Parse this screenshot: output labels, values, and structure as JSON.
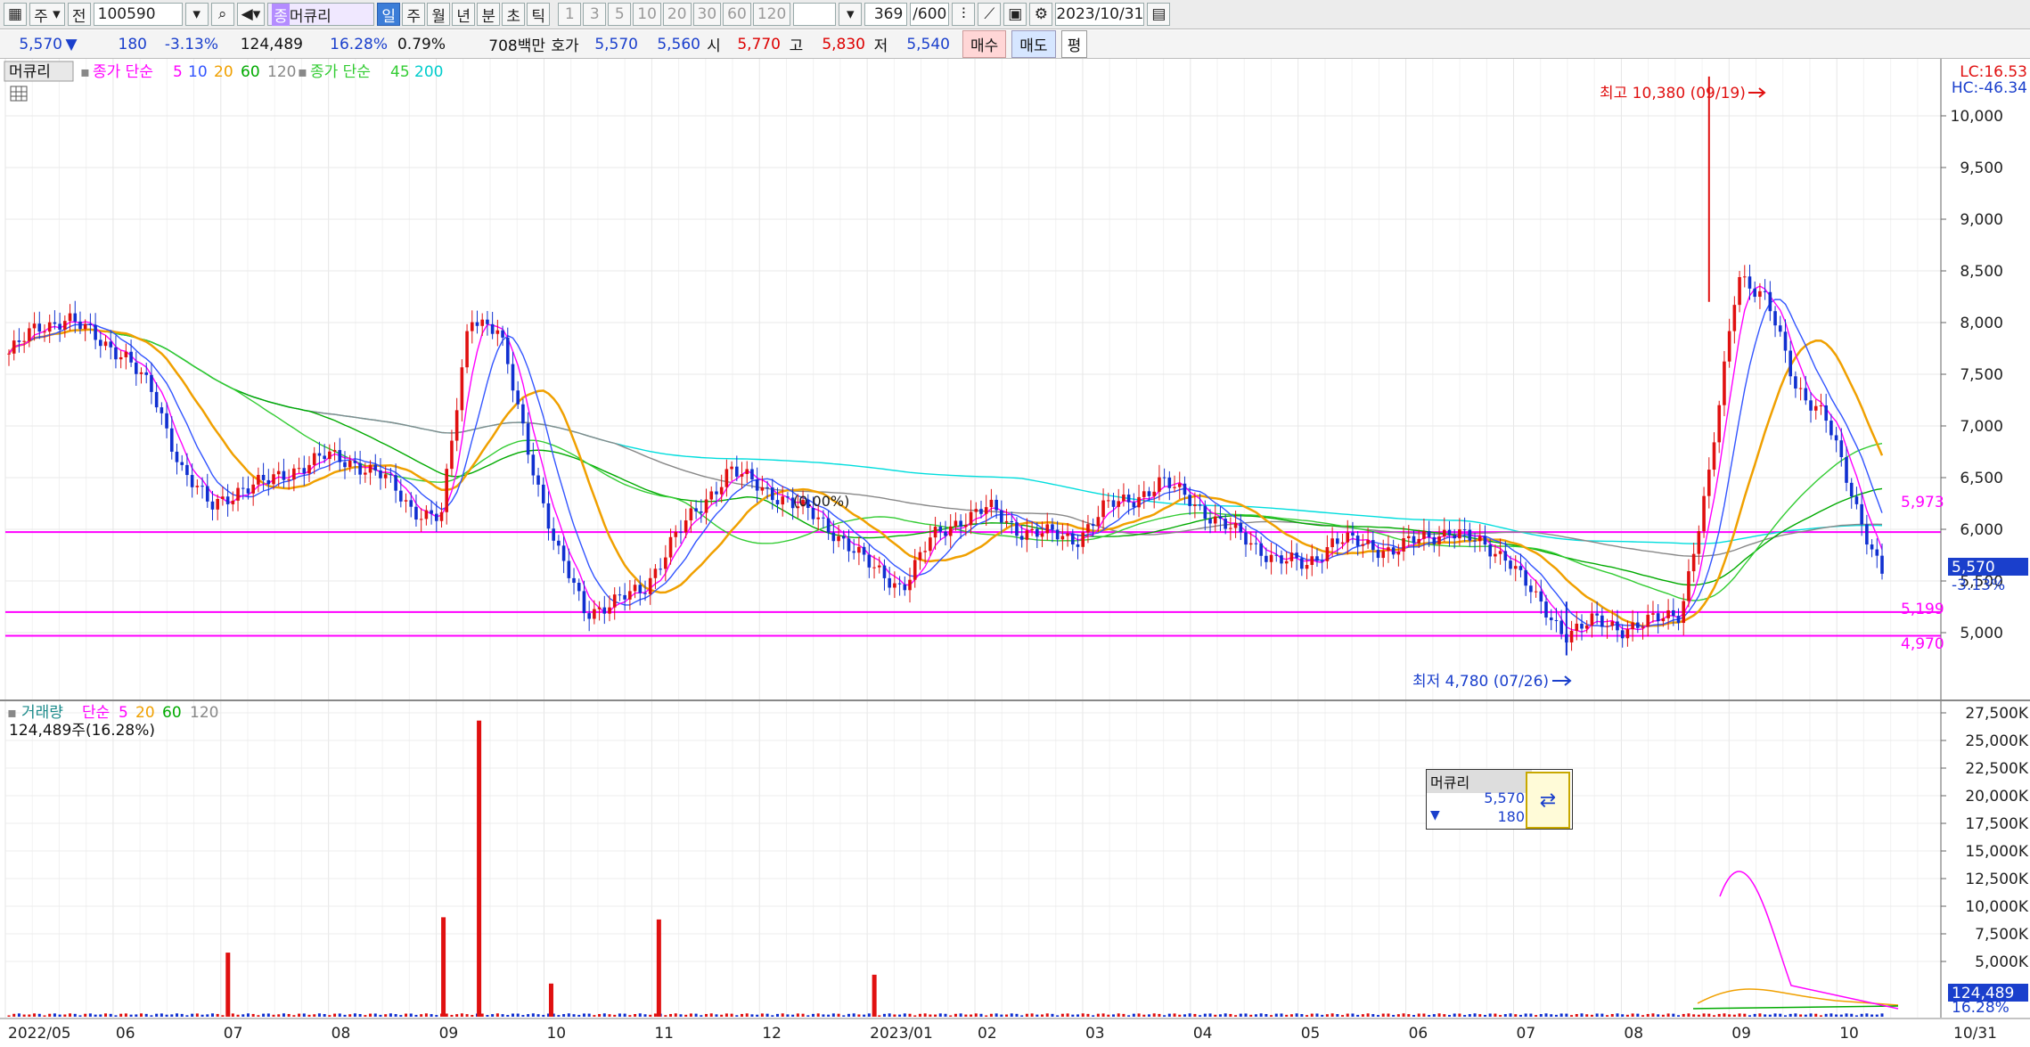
{
  "toolbar": {
    "market_label": "주",
    "prev_label": "전",
    "stock_code": "100590",
    "stock_name_prefix": "종",
    "stock_name": "머큐리",
    "period_tabs": [
      "일",
      "주",
      "월",
      "년",
      "분",
      "초",
      "틱"
    ],
    "active_period": "일",
    "minute_options": [
      "1",
      "3",
      "5",
      "10",
      "20",
      "30",
      "60",
      "120"
    ],
    "count_display": "369",
    "count_total": "/600",
    "date": "2023/10/31"
  },
  "info": {
    "price": "5,570",
    "change": "180",
    "change_pct": "-3.13%",
    "volume": "124,489",
    "volume_pct": "16.28%",
    "turnover_pct": "0.79%",
    "amount": "708백만",
    "quote_label": "호가",
    "ask": "5,570",
    "bid": "5,560",
    "open_label": "시",
    "open": "5,770",
    "high_label": "고",
    "high": "5,830",
    "low_label": "저",
    "low": "5,540",
    "buy_label": "매수",
    "sell_label": "매도",
    "avg_label": "평"
  },
  "price_panel": {
    "title": "머큐리",
    "ma_label1": "종가 단순",
    "ma_periods1": [
      "5",
      "10",
      "20",
      "60",
      "120"
    ],
    "ma_label2": "종가 단순",
    "ma_periods2": [
      "45",
      "200"
    ],
    "lc": "LC:16.53",
    "hc": "HC:-46.34",
    "high_annotation": "최고 10,380 (09/19)",
    "low_annotation": "최저 4,780 (07/26)",
    "level_labels": [
      "5,973",
      "5,199",
      "4,970"
    ],
    "current_price": "5,570",
    "current_pct": "-3.13%",
    "pct_note": "(0.00%)",
    "y_ticks": [
      "10,000",
      "9,500",
      "9,000",
      "8,500",
      "8,000",
      "7,500",
      "7,000",
      "6,500",
      "6,000",
      "5,500",
      "5,000"
    ]
  },
  "volume_panel": {
    "title": "거래량",
    "ma_label": "단순",
    "ma_periods": [
      "5",
      "20",
      "60",
      "120"
    ],
    "summary": "124,489주(16.28%)",
    "y_ticks": [
      "27,500K",
      "25,000K",
      "22,500K",
      "20,000K",
      "17,500K",
      "15,000K",
      "12,500K",
      "10,000K",
      "7,500K",
      "5,000K"
    ],
    "current_volume": "124,489",
    "current_pct": "16.28%"
  },
  "x_axis": {
    "labels": [
      "2022/05",
      "06",
      "07",
      "08",
      "09",
      "10",
      "11",
      "12",
      "2023/01",
      "02",
      "03",
      "04",
      "05",
      "06",
      "07",
      "08",
      "09",
      "10",
      "10/31"
    ]
  },
  "mini_window": {
    "name": "머큐리",
    "price": "5,570",
    "change": "180",
    "arrow": "▼",
    "icon": "equal-arrow-icon"
  },
  "colors": {
    "up": "#e01010",
    "down": "#1030d0",
    "ma5": "#ff00ff",
    "ma10": "#3355ff",
    "ma20": "#f0a000",
    "ma60": "#00aa00",
    "ma120": "#888888",
    "ma45": "#33cc33",
    "ma200": "#00dddd",
    "level": "#ff00ff"
  },
  "chart_data": {
    "type": "candlestick",
    "x_start": "2022/05",
    "x_end": "2023/10/31",
    "ylim": [
      4700,
      10400
    ],
    "closes_weekly": [
      7700,
      7950,
      8050,
      7850,
      7700,
      7300,
      6600,
      6200,
      6400,
      6450,
      6600,
      6700,
      6650,
      6500,
      6200,
      6100,
      8100,
      7900,
      6800,
      5800,
      5200,
      5300,
      5400,
      5900,
      6200,
      6600,
      6400,
      6300,
      6100,
      5900,
      5600,
      5450,
      5900,
      6100,
      6200,
      6000,
      5950,
      5900,
      6200,
      6300,
      6450,
      6300,
      6050,
      5900,
      5700,
      5650,
      5900,
      5850,
      5800,
      5900,
      6000,
      5850,
      5750,
      5300,
      5000,
      5100,
      5050,
      5100,
      5200,
      6500,
      8500,
      8200,
      7400,
      7100,
      6300,
      5570
    ],
    "volume_spikes_k": [
      {
        "period": "2022/09",
        "value": 9000
      },
      {
        "period": "2022/11",
        "value": 8800
      },
      {
        "period": "2023/01",
        "value": 3800
      },
      {
        "period": "2023/07",
        "value": 5800
      },
      {
        "period": "2023/09",
        "value": 26800
      },
      {
        "period": "2023/10",
        "value": 3000
      }
    ],
    "levels": [
      5973,
      5199,
      4970
    ],
    "high": {
      "value": 10380,
      "date": "09/19"
    },
    "low": {
      "value": 4780,
      "date": "07/26"
    }
  }
}
